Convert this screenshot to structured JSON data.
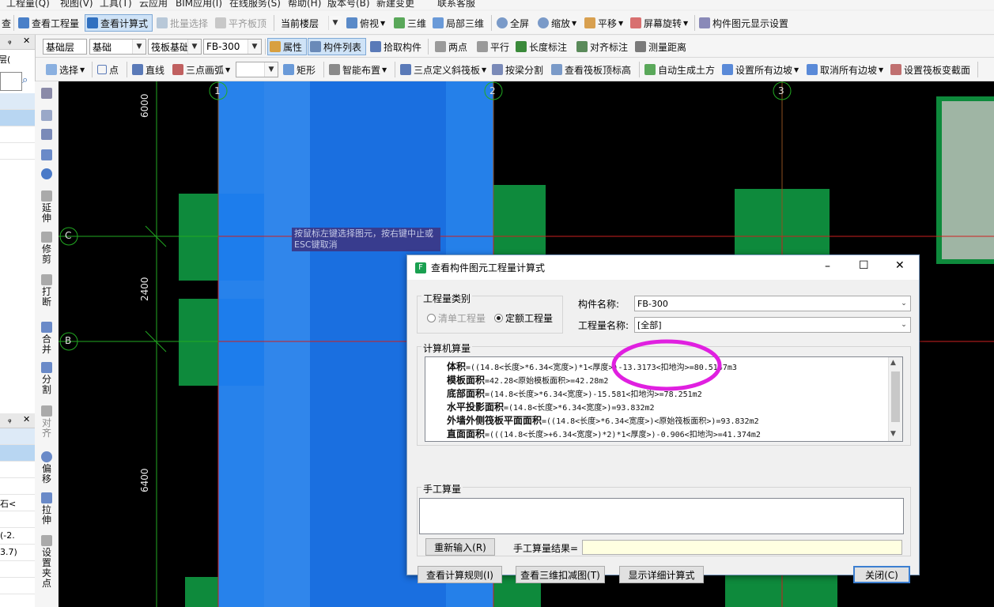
{
  "menubar": {
    "items": [
      "工程量(Q)",
      "视图(V)",
      "工具(T)",
      "云应用",
      "BIM应用(I)",
      "在线服务(S)",
      "帮助(H)",
      "版本号(B)",
      "新建变更",
      "联系客服"
    ]
  },
  "toolbar1": {
    "items": [
      "查",
      "查看工程量",
      "查看计算式",
      "批量选择",
      "平齐板顶",
      "俯视",
      "三维",
      "局部三维",
      "全屏",
      "缩放",
      "平移",
      "屏幕旋转",
      "构件图元显示设置"
    ],
    "floor_combo": "当前楼层"
  },
  "toolbar2": {
    "combos": [
      "基础层",
      "基础",
      "筏板基础",
      "FB-300"
    ],
    "items": [
      "属性",
      "构件列表",
      "拾取构件",
      "两点",
      "平行",
      "长度标注",
      "对齐标注",
      "测量距离"
    ]
  },
  "toolbar3": {
    "items": [
      "选择",
      "点",
      "直线",
      "三点画弧",
      "矩形",
      "智能布置",
      "三点定义斜筏板",
      "按梁分割",
      "查看筏板顶标高",
      "自动生成土方",
      "设置所有边坡",
      "取消所有边坡",
      "设置筏板变截面"
    ]
  },
  "leftpanel": {
    "pin_label": "ᵩ",
    "close_label": "✕",
    "snippets": [
      "层(",
      "石<",
      "(-2.",
      "3.7)"
    ]
  },
  "vstrip": {
    "tools": [
      "延伸",
      "修剪",
      "打断",
      "合并",
      "分割",
      "对齐",
      "偏移",
      "拉伸",
      "设置夹点"
    ]
  },
  "canvas": {
    "axis_top": [
      "1",
      "2",
      "3"
    ],
    "axis_left": [
      "C",
      "B"
    ],
    "dims": [
      "6000",
      "2400",
      "6400"
    ],
    "tooltip": "按鼠标左键选择图元，按右键中止或ESC键取消"
  },
  "dialog": {
    "title": "查看构件图元工程量计算式",
    "min_icon": "–",
    "max_icon": "☐",
    "close_icon": "✕",
    "qty_type": {
      "label": "工程量类别",
      "options": [
        "清单工程量",
        "定额工程量"
      ],
      "selected": 1
    },
    "component_name": {
      "label": "构件名称:",
      "value": "FB-300"
    },
    "qty_name": {
      "label": "工程量名称:",
      "value": "[全部]"
    },
    "computer_calc": {
      "label": "计算机算量",
      "lines": [
        {
          "name": "体积",
          "formula": "=((14.8<长度>*6.34<宽度>)*1<厚度>)-13.3173<扣地沟>=80.5147m3"
        },
        {
          "name": "模板面积",
          "formula": "=42.28<原始模板面积>=42.28m2"
        },
        {
          "name": "底部面积",
          "formula": "=(14.8<长度>*6.34<宽度>)-15.581<扣地沟>=78.251m2"
        },
        {
          "name": "水平投影面积",
          "formula": "=(14.8<长度>*6.34<宽度>)=93.832m2"
        },
        {
          "name": "外墙外侧筏板平面面积",
          "formula": "=((14.8<长度>*6.34<宽度>)<原始筏板面积>)=93.832m2"
        },
        {
          "name": "直面面积",
          "formula": "=(((14.8<长度>+6.34<宽度>)*2)*1<厚度>)-0.906<扣地沟>=41.374m2"
        }
      ]
    },
    "manual_calc": {
      "label": "手工算量",
      "reinput_button": "重新输入(R)",
      "result_label": "手工算量结果=",
      "result_value": ""
    },
    "buttons": {
      "rules": "查看计算规则(I)",
      "view3d": "查看三维扣减图(T)",
      "detail": "显示详细计算式",
      "close": "关闭(C)"
    }
  },
  "colors": {
    "annotation_circle": "#e020e0",
    "blue_slab": "#1a6fe0",
    "green_column": "#0e8a3c",
    "axis_red": "#cc2020"
  }
}
